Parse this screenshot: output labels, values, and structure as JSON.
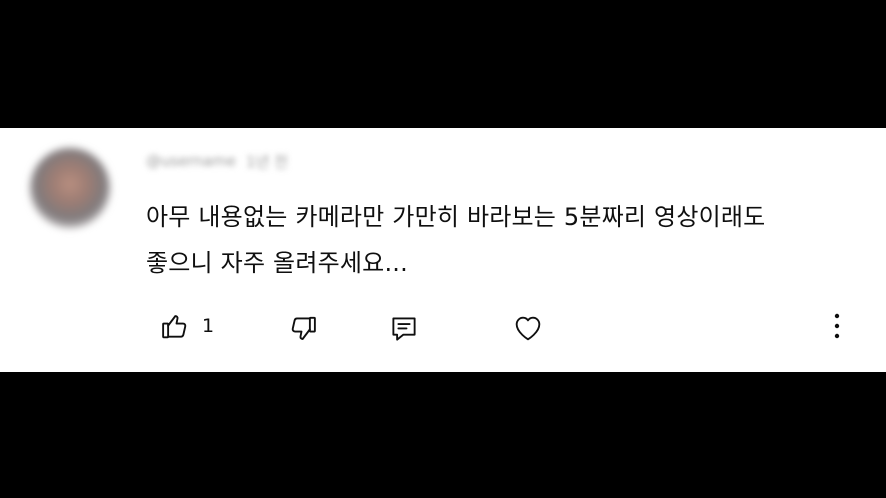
{
  "comment": {
    "author": "@username",
    "time": "1년 전",
    "lines": [
      "아무 내용없는 카메라만 가만히 바라보는 5분짜리 영상이래도",
      "좋으니 자주 올려주세요..."
    ],
    "like_count": "1"
  },
  "icons": {
    "like": "thumbs-up-icon",
    "dislike": "thumbs-down-icon",
    "reply": "reply-icon",
    "heart": "heart-icon",
    "more": "more-vertical-icon"
  },
  "colors": {
    "background": "#000000",
    "card": "#ffffff",
    "text": "#0f0f0f",
    "meta": "#9a9a9a"
  }
}
